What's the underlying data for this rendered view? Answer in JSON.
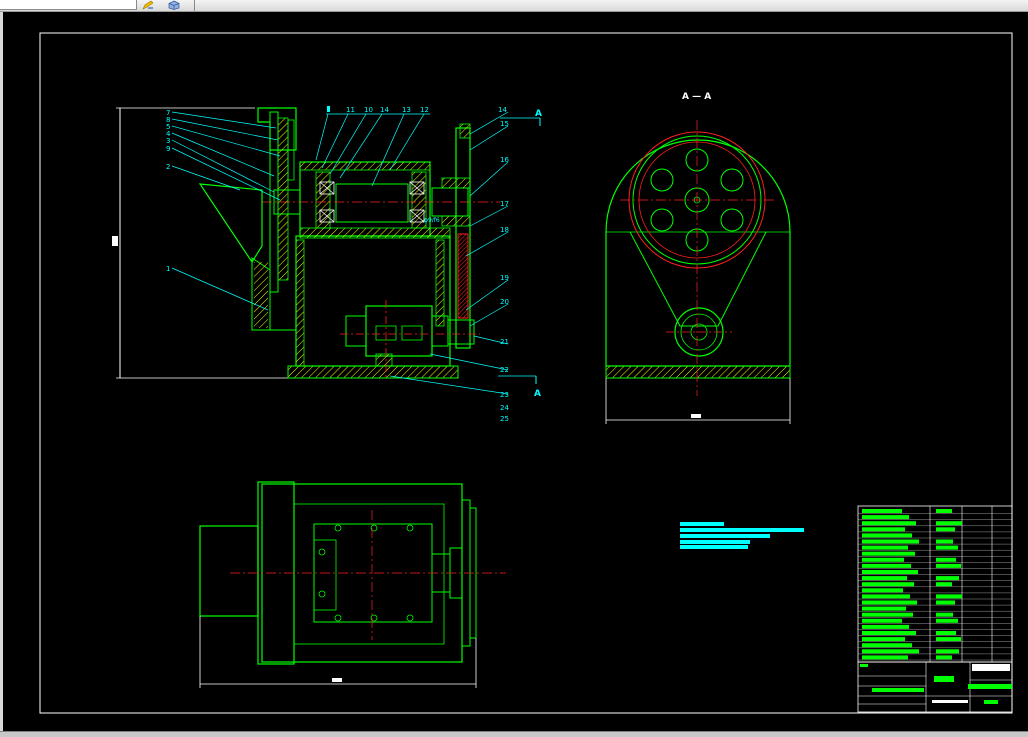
{
  "toolbar": {
    "icons": [
      "pencil-icon",
      "cube-icon"
    ]
  },
  "colors": {
    "background": "#000000",
    "outline": "#00ff00",
    "centerline": "#ff2020",
    "dimension": "#ffffff",
    "leader": "#00ffff",
    "hatch": "#ffff00",
    "border": "#ffffff",
    "table_fill": "#00ff00",
    "label_text": "#00ffff"
  },
  "drawing": {
    "section_label": "A — A",
    "section_mark_top": "A",
    "section_mark_bottom": "A",
    "callouts_left": [
      "7",
      "8",
      "5",
      "4",
      "3",
      "9",
      "2",
      "1"
    ],
    "callouts_top": [
      "11",
      "10",
      "14",
      "13",
      "12"
    ],
    "callouts_right": [
      "14",
      "15",
      "16",
      "17",
      "18",
      "19",
      "20",
      "21",
      "22",
      "23",
      "24",
      "25"
    ],
    "fit_note": "φ9/f6"
  }
}
